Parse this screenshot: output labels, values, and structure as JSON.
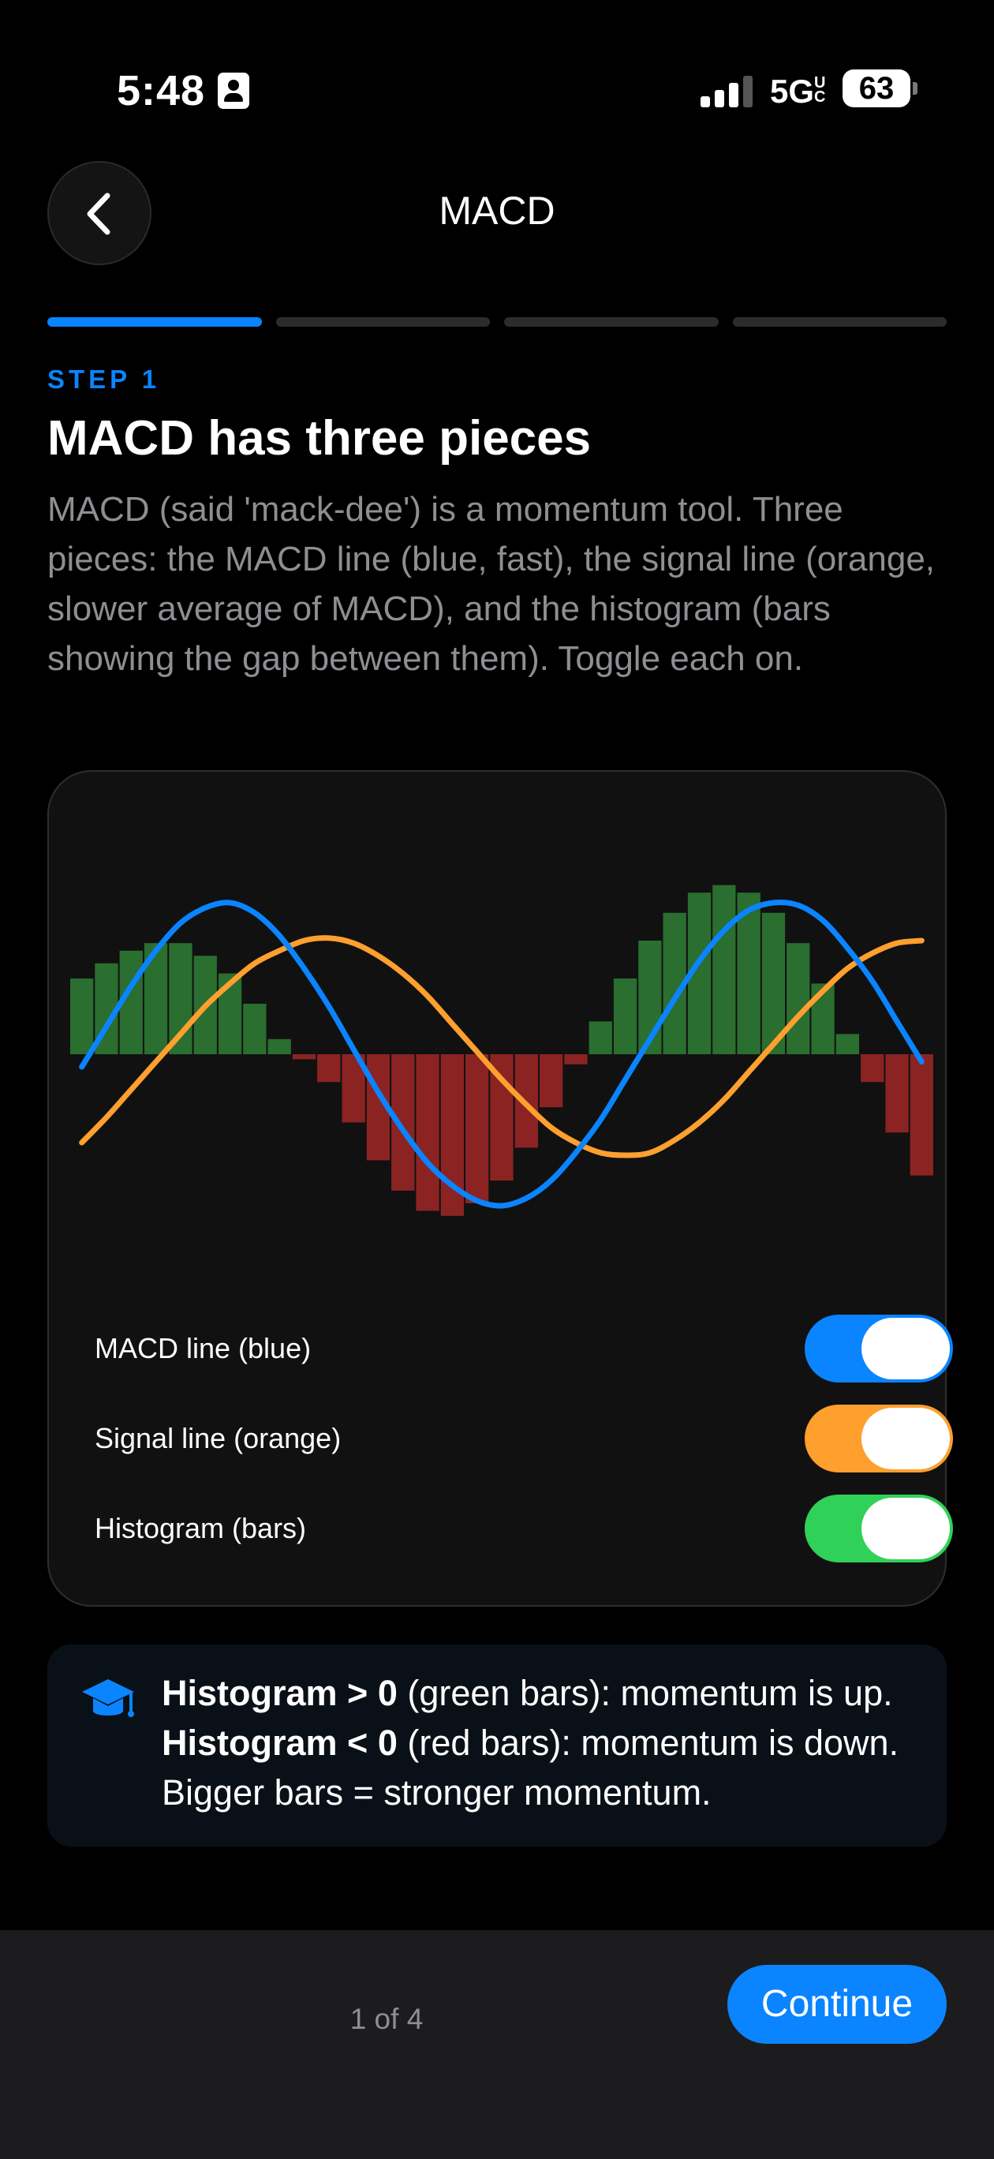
{
  "status_bar": {
    "time": "5:48",
    "network": "5G",
    "network_suffix": "UC",
    "battery": "63",
    "icons": [
      "contact-card-icon",
      "signal-bars-icon",
      "battery-icon"
    ]
  },
  "header": {
    "title": "MACD",
    "back_icon": "chevron-left-icon"
  },
  "progress": {
    "total_steps": 4,
    "current_step": 1
  },
  "step": {
    "label": "STEP 1",
    "heading": "MACD has three pieces",
    "description": "MACD (said 'mack-dee') is a momentum tool. Three pieces: the MACD line (blue, fast), the signal line (orange, slower average of MACD), and the histogram (bars showing the gap between them). Toggle each on."
  },
  "colors": {
    "accent": "#0a84ff",
    "macd": "#0a84ff",
    "signal": "#ff9f2e",
    "hist_positive": "#2a6e30",
    "hist_negative": "#8b2323",
    "toggle_green": "#30d158"
  },
  "chart_data": {
    "type": "line",
    "series": [
      {
        "name": "MACD line",
        "color": "#0a84ff",
        "values": [
          -0.05,
          0.11,
          0.27,
          0.41,
          0.52,
          0.58,
          0.6,
          0.56,
          0.47,
          0.34,
          0.19,
          0.02,
          -0.15,
          -0.3,
          -0.43,
          -0.52,
          -0.58,
          -0.6,
          -0.57,
          -0.5,
          -0.39,
          -0.26,
          -0.1,
          0.06,
          0.22,
          0.37,
          0.49,
          0.57,
          0.6,
          0.59,
          0.53,
          0.42,
          0.29,
          0.13,
          -0.03
        ]
      },
      {
        "name": "Signal line",
        "color": "#ff9f2e",
        "values": [
          -0.35,
          -0.25,
          -0.14,
          -0.03,
          0.08,
          0.19,
          0.28,
          0.36,
          0.41,
          0.45,
          0.46,
          0.44,
          0.39,
          0.32,
          0.23,
          0.12,
          0.01,
          -0.1,
          -0.2,
          -0.29,
          -0.35,
          -0.39,
          -0.4,
          -0.39,
          -0.34,
          -0.27,
          -0.18,
          -0.07,
          0.04,
          0.15,
          0.25,
          0.34,
          0.4,
          0.44,
          0.45
        ]
      },
      {
        "name": "Histogram",
        "color": "#2a6e30",
        "values": [
          0.3,
          0.36,
          0.41,
          0.44,
          0.44,
          0.39,
          0.32,
          0.2,
          0.06,
          -0.02,
          -0.11,
          -0.27,
          -0.42,
          -0.54,
          -0.62,
          -0.64,
          -0.59,
          -0.5,
          -0.37,
          -0.21,
          -0.04,
          0.13,
          0.3,
          0.45,
          0.56,
          0.64,
          0.67,
          0.64,
          0.56,
          0.44,
          0.28,
          0.08,
          -0.11,
          -0.31,
          -0.48
        ]
      }
    ],
    "x_count": 35,
    "ylim": [
      -0.75,
      0.75
    ],
    "grid": false,
    "legend": "none"
  },
  "toggles": [
    {
      "label": "MACD line (blue)",
      "on": true,
      "color": "#0a84ff"
    },
    {
      "label": "Signal line (orange)",
      "on": true,
      "color": "#ff9f2e"
    },
    {
      "label": "Histogram (bars)",
      "on": true,
      "color": "#30d158"
    }
  ],
  "tip": {
    "icon": "graduation-cap-icon",
    "part1_bold": "Histogram > 0",
    "part1_rest": " (green bars): momentum is up. ",
    "part2_bold": "Histogram < 0",
    "part2_rest": " (red bars): momentum is down. Bigger bars = stronger momentum."
  },
  "footer": {
    "page_indicator": "1 of 4",
    "continue_label": "Continue"
  }
}
